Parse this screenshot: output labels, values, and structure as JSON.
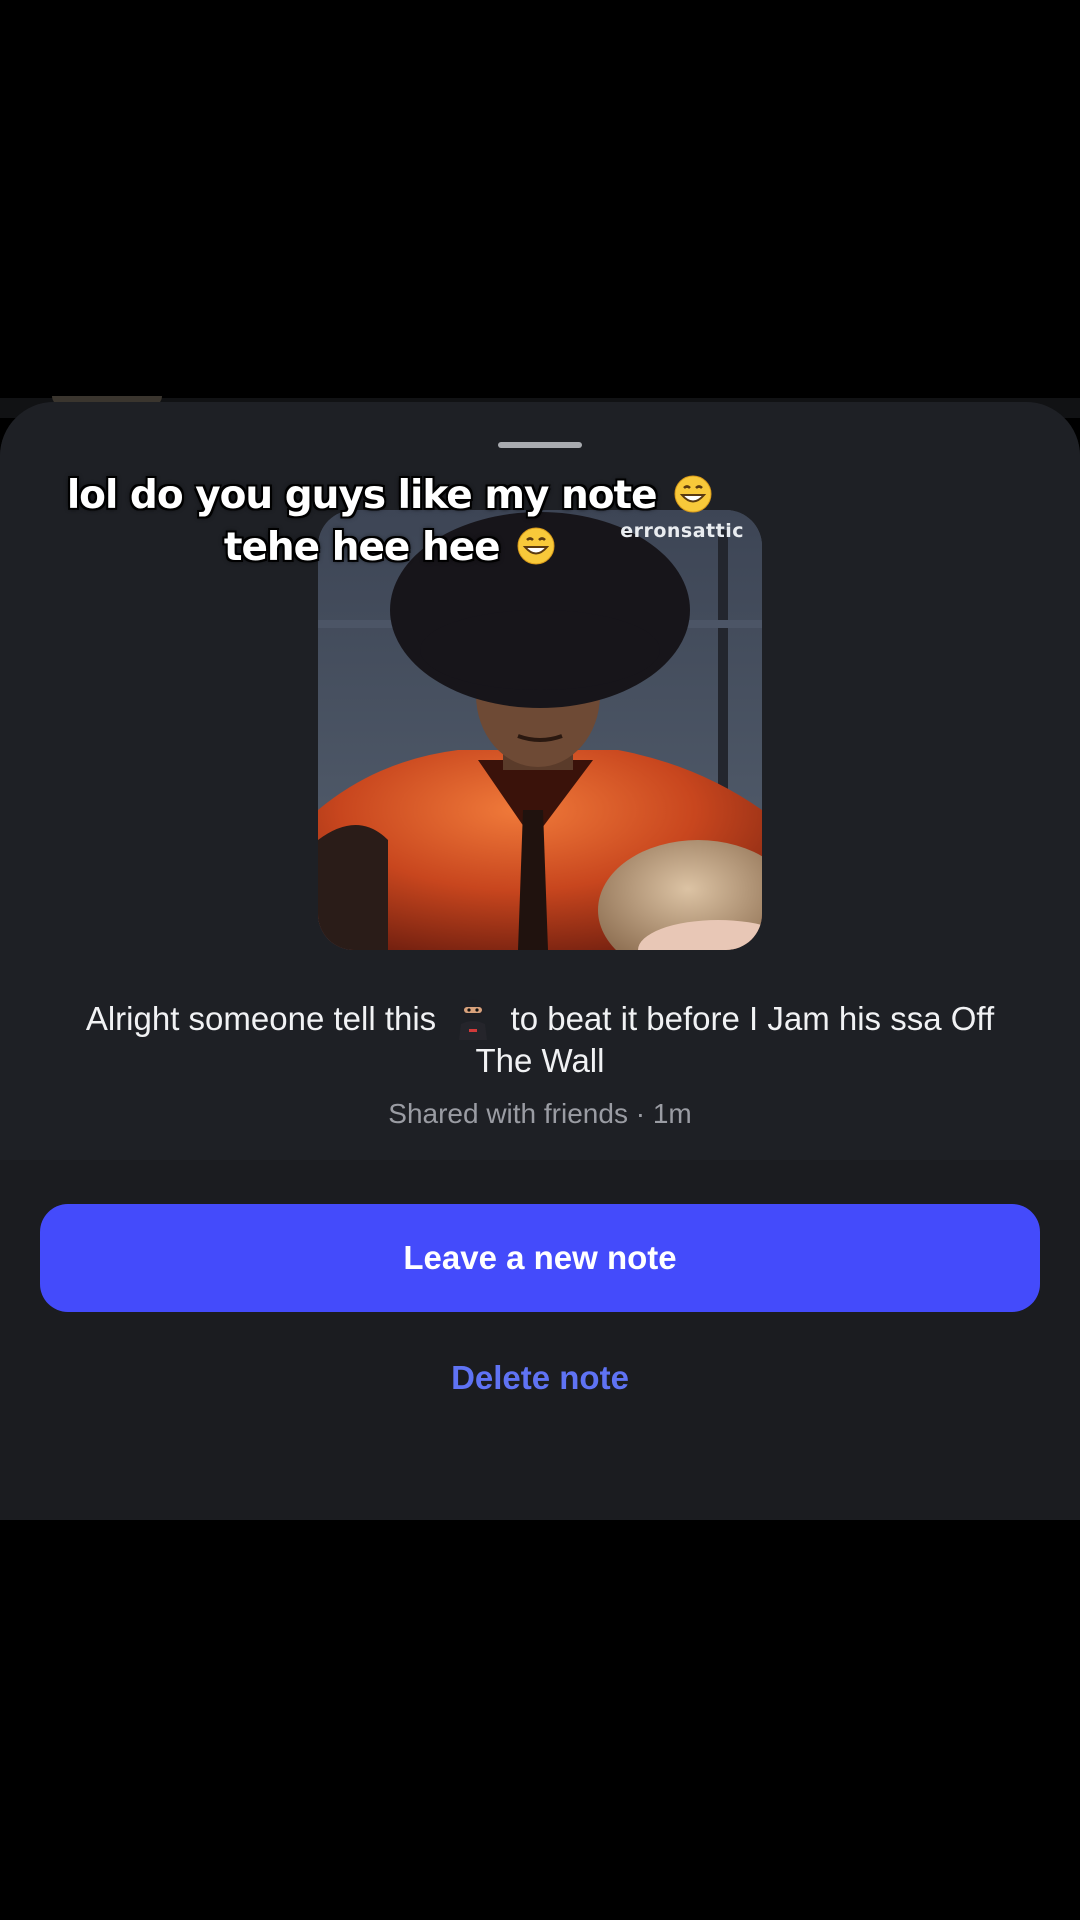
{
  "caption": {
    "line1": "lol do you guys like my note",
    "line2": "tehe hee hee",
    "emoji": "grinning-face-icon"
  },
  "gif": {
    "watermark": "erronsattic"
  },
  "note": {
    "text_before": "Alright someone tell this",
    "emoji": "ninja-icon",
    "text_after": "to beat it before I Jam his ssa Off The Wall",
    "meta": "Shared with friends · 1m"
  },
  "actions": {
    "primary_label": "Leave a new note",
    "secondary_label": "Delete note"
  },
  "colors": {
    "primary_button": "#444bfb",
    "link": "#5f73f4",
    "sheet": "#1b1c21"
  }
}
